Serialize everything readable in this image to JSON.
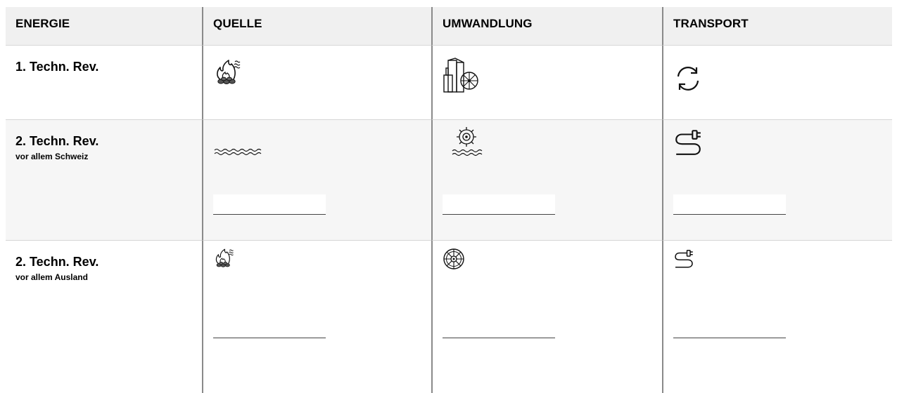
{
  "headers": {
    "energie": "ENERGIE",
    "quelle": "QUELLE",
    "umwandlung": "UMWANDLUNG",
    "transport": "TRANSPORT"
  },
  "rows": [
    {
      "title": "1. Techn. Rev.",
      "subtitle": "",
      "quelle_icon": "fire-coal-icon",
      "umwandlung_icon": "steam-engine-icon",
      "transport_icon": "cycle-arrows-icon"
    },
    {
      "title": "2. Techn. Rev.",
      "subtitle": "vor allem Schweiz",
      "quelle_icon": "water-waves-icon",
      "umwandlung_icon": "water-turbine-icon",
      "transport_icon": "power-cable-plug-icon"
    },
    {
      "title": "2. Techn. Rev.",
      "subtitle": "vor allem Ausland",
      "quelle_icon": "fire-coal-icon",
      "umwandlung_icon": "turbine-wheel-icon",
      "transport_icon": "power-cable-plug-icon"
    }
  ],
  "colors": {
    "header_bg": "#f0f0f0",
    "shaded_row_bg": "#f6f6f6",
    "column_separator": "#8a8a8a",
    "answer_line": "#444444"
  }
}
